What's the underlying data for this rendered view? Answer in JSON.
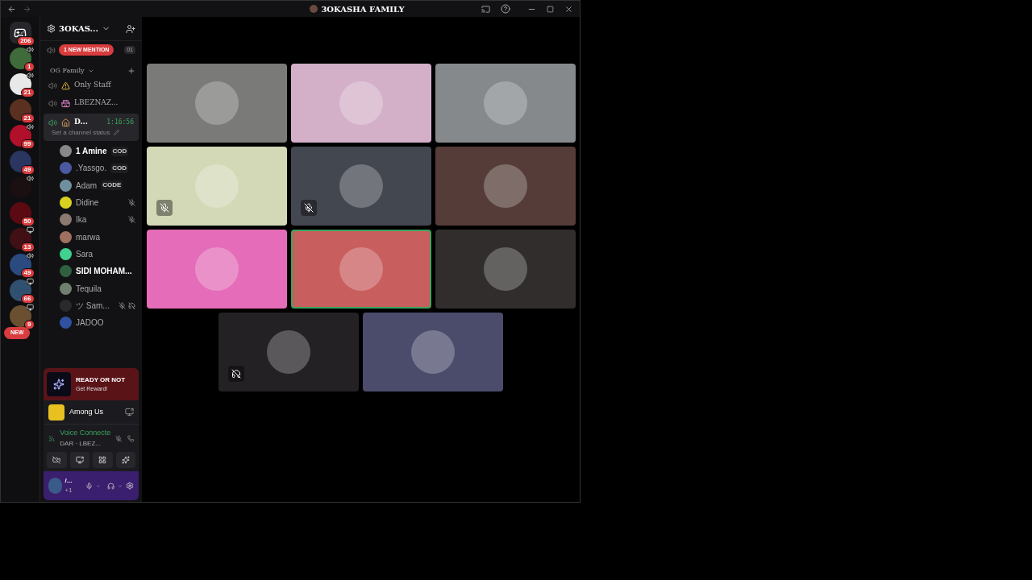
{
  "window": {
    "title": "3OKASHA FAMILY"
  },
  "servers": [
    {
      "badge": "206",
      "kind": "home"
    },
    {
      "badge": "1",
      "kind": "voice",
      "color": "#3f6b3a"
    },
    {
      "badge": "21",
      "kind": "voice",
      "color": "#e8e8e8"
    },
    {
      "badge": "21",
      "kind": "plain",
      "color": "#5a3020"
    },
    {
      "badge": "99",
      "kind": "voice",
      "color": "#b0102a"
    },
    {
      "badge": "49",
      "kind": "plain",
      "color": "#2a3560"
    },
    {
      "kind": "voice",
      "color": "#1a1012"
    },
    {
      "badge": "50",
      "kind": "plain",
      "color": "#5a0a10"
    },
    {
      "badge": "13",
      "kind": "screen",
      "color": "#401014"
    },
    {
      "badge": "49",
      "kind": "voice",
      "color": "#2a4a80"
    },
    {
      "badge": "66",
      "kind": "screen",
      "color": "#305070"
    },
    {
      "badge": "9",
      "kind": "screen",
      "color": "#6a5030"
    }
  ],
  "new_pill": "NEW",
  "server_name": "3OKAS...",
  "mention_pill": "1 NEW MENTION",
  "mention_count": "01",
  "category": "OG Family",
  "channels": [
    {
      "name": "Only Staff",
      "selected": false
    },
    {
      "name": "LBEZNAZ...",
      "selected": false
    },
    {
      "name": "D...",
      "selected": true,
      "time": "1:16:56",
      "status": "Set a channel status"
    }
  ],
  "members": [
    {
      "name": "1 Amine",
      "bold": true,
      "badge": "COD",
      "muted": false,
      "deafened": false,
      "color": "#888888"
    },
    {
      "name": ".Yassgo.",
      "bold": false,
      "badge": "COD",
      "muted": false,
      "deafened": false,
      "color": "#4a5aa0"
    },
    {
      "name": "Adam",
      "bold": false,
      "badge": "CODE",
      "muted": false,
      "deafened": false,
      "color": "#7090a0"
    },
    {
      "name": "Didine",
      "bold": false,
      "muted": true,
      "deafened": false,
      "color": "#d8d020"
    },
    {
      "name": "Ika",
      "bold": false,
      "muted": true,
      "deafened": false,
      "color": "#8a7a70"
    },
    {
      "name": "marwa",
      "bold": false,
      "muted": false,
      "deafened": false,
      "color": "#a07060"
    },
    {
      "name": "Sara",
      "bold": false,
      "muted": false,
      "deafened": false,
      "color": "#40d090"
    },
    {
      "name": "SIDI MOHAM...",
      "bold": true,
      "muted": false,
      "deafened": false,
      "color": "#306040"
    },
    {
      "name": "Tequila",
      "bold": false,
      "muted": false,
      "deafened": false,
      "color": "#708070"
    },
    {
      "name": "ツ Sam...",
      "bold": false,
      "muted": true,
      "deafened": true,
      "color": "#2a2a2a"
    },
    {
      "name": "JADOO",
      "bold": false,
      "muted": false,
      "deafened": false,
      "color": "#3050a0"
    }
  ],
  "promo": {
    "logo": "READY OR NOT",
    "action": "Get Reward!"
  },
  "activity": {
    "game": "Among Us"
  },
  "voice": {
    "status": "Voice Connecte",
    "channel": "DAR · LBEZ..."
  },
  "user": {
    "name": "/...",
    "extra": "+1"
  },
  "tiles": [
    {
      "color": "#7a7a78",
      "kind": "plain",
      "speaking": false
    },
    {
      "color": "#d4b0c8",
      "kind": "plain",
      "speaking": false
    },
    {
      "color": "#85898b",
      "kind": "plain",
      "speaking": false
    },
    {
      "color": "#d3d8b6",
      "kind": "muted",
      "speaking": false
    },
    {
      "color": "#43474f",
      "kind": "muted",
      "speaking": false
    },
    {
      "color": "#553c39",
      "kind": "plain",
      "speaking": false
    },
    {
      "color": "#e46cb8",
      "kind": "plain",
      "speaking": false
    },
    {
      "color": "#c95e5e",
      "kind": "plain",
      "speaking": true
    },
    {
      "color": "#302d2c",
      "kind": "plain",
      "speaking": false
    },
    {
      "color": "#232124",
      "kind": "deafened",
      "speaking": false
    },
    {
      "color": "#4b4c6c",
      "kind": "plain",
      "speaking": false
    }
  ]
}
